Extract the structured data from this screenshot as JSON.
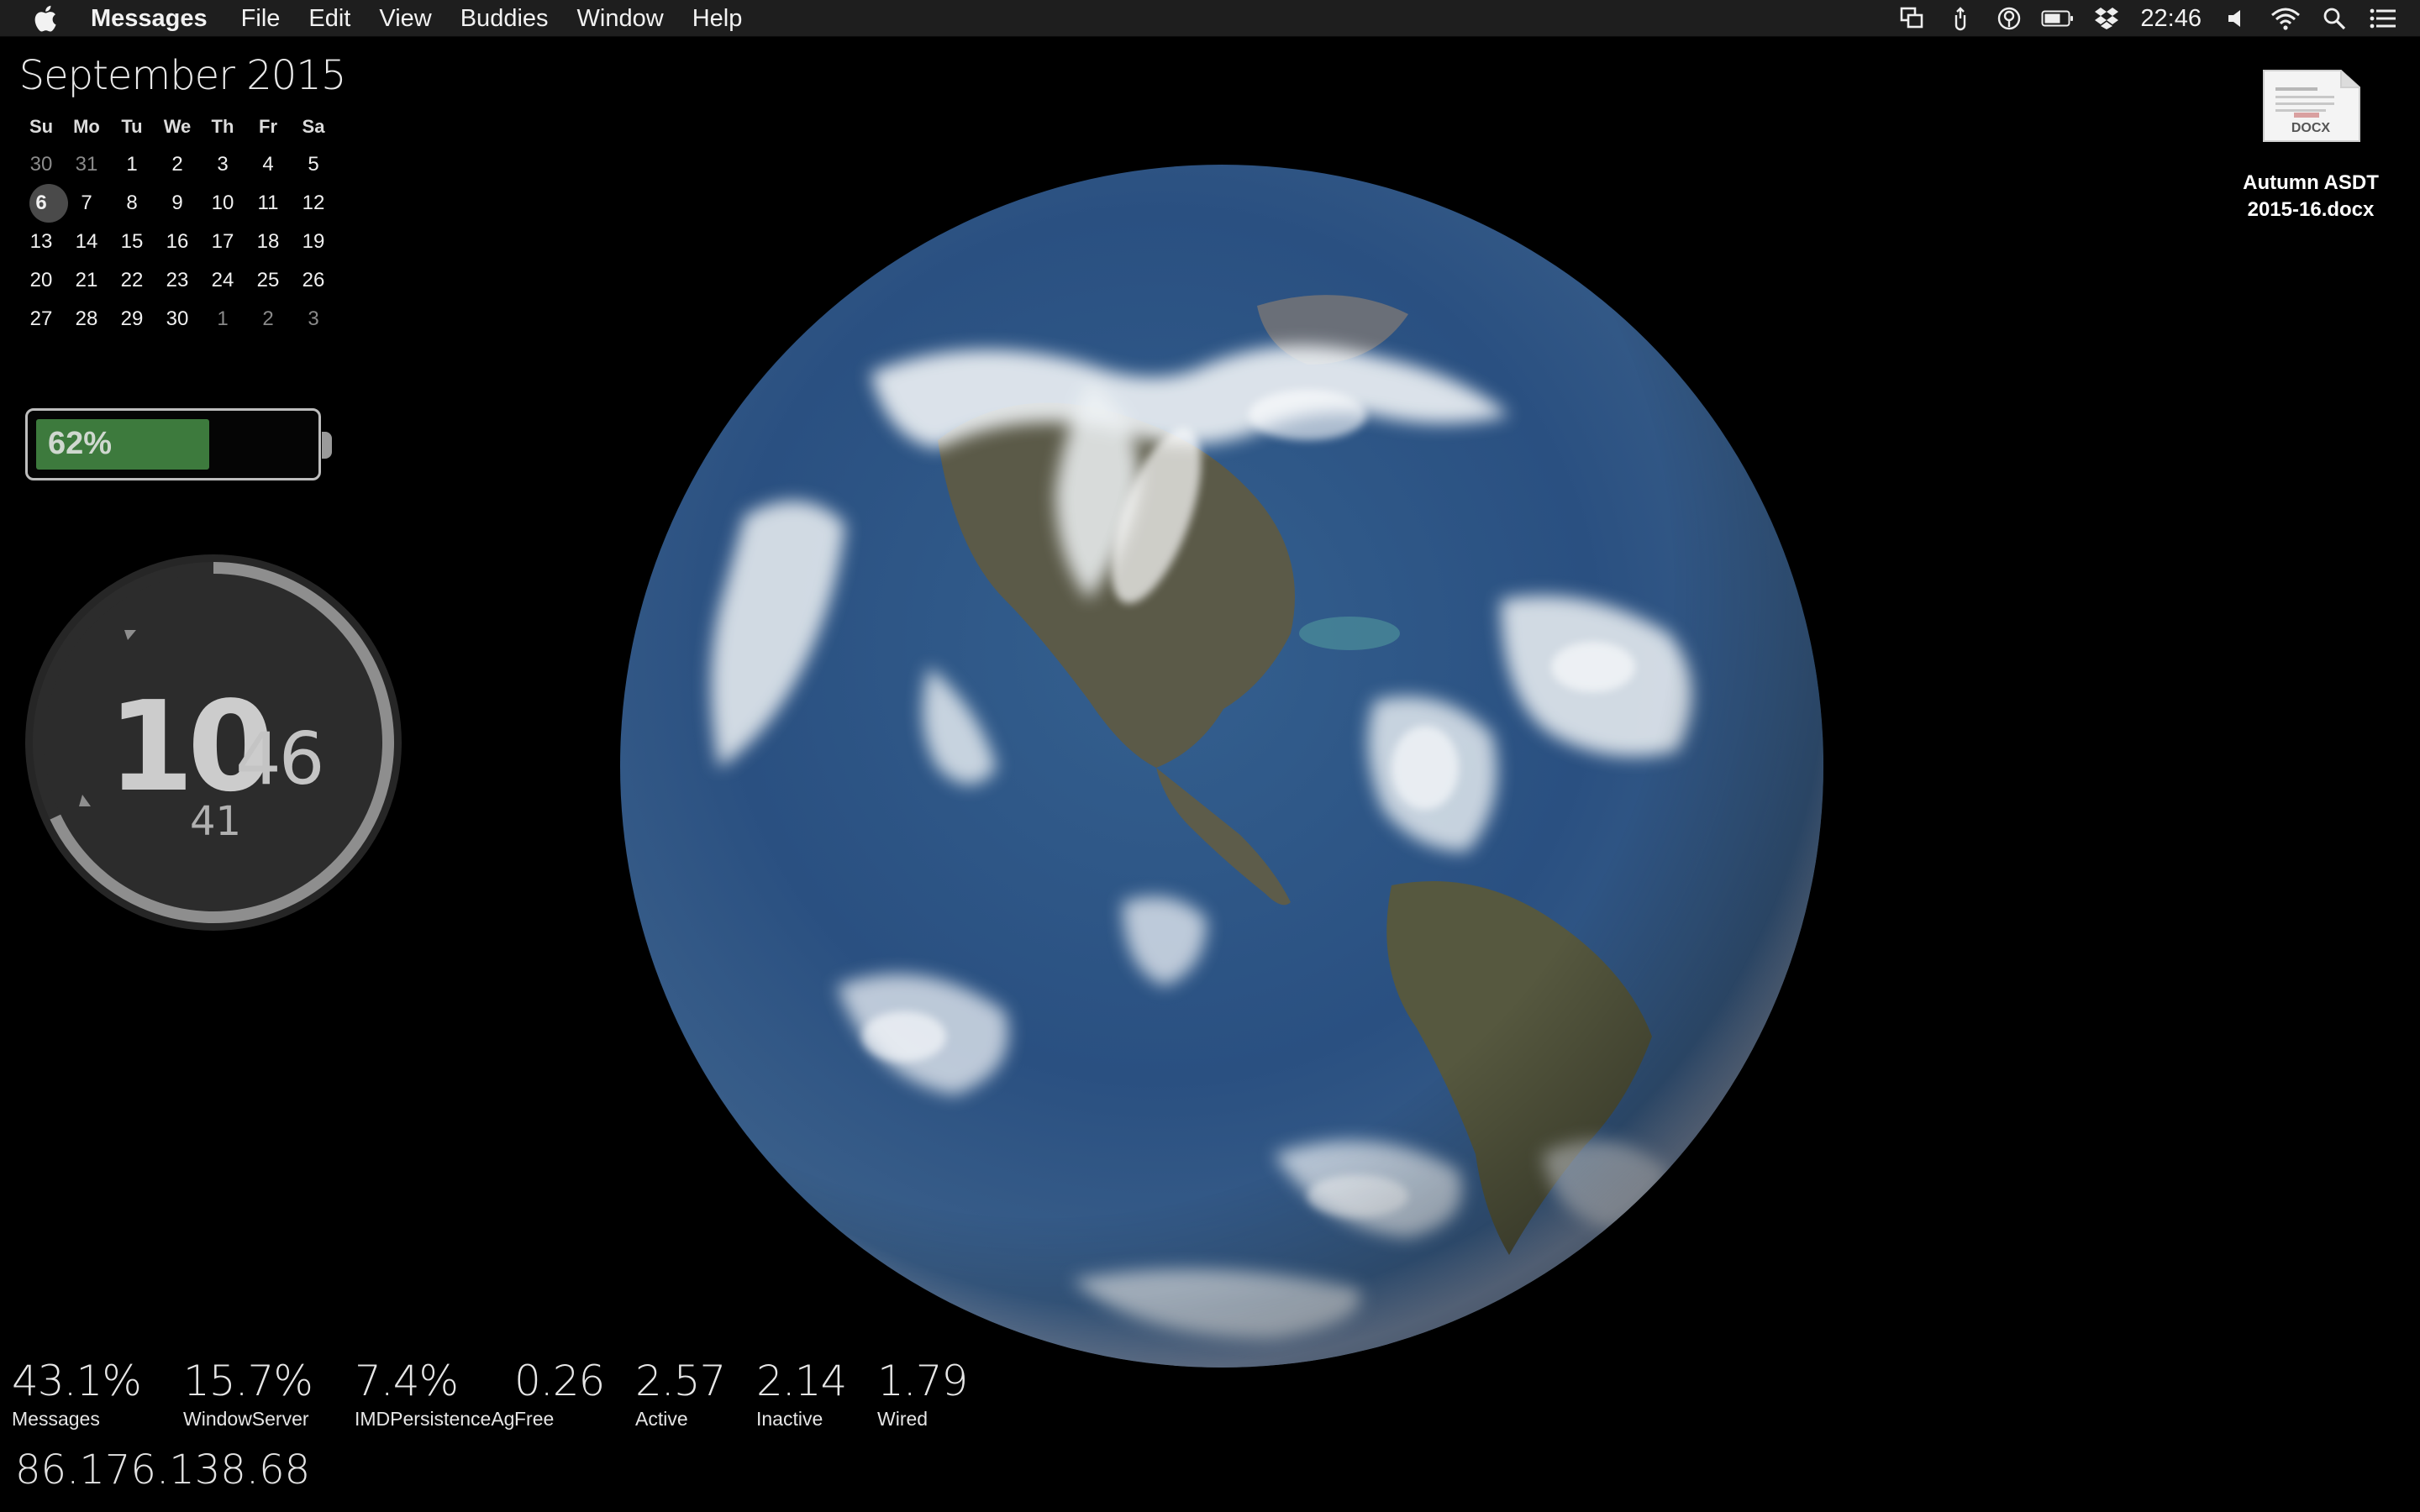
{
  "menubar": {
    "app_name": "Messages",
    "items": [
      "File",
      "Edit",
      "View",
      "Buddies",
      "Window",
      "Help"
    ],
    "status_icons": [
      "screen-share-icon",
      "bluetooth-arrow-icon",
      "sync-icon",
      "battery-icon",
      "dropbox-icon"
    ],
    "clock": "22:46",
    "right_icons": [
      "volume-icon",
      "wifi-icon",
      "spotlight-search-icon",
      "notification-center-icon"
    ]
  },
  "calendar": {
    "title": "September 2015",
    "weekdays": [
      "Su",
      "Mo",
      "Tu",
      "We",
      "Th",
      "Fr",
      "Sa"
    ],
    "weeks": [
      [
        "30",
        "31",
        "1",
        "2",
        "3",
        "4",
        "5"
      ],
      [
        "6",
        "7",
        "8",
        "9",
        "10",
        "11",
        "12"
      ],
      [
        "13",
        "14",
        "15",
        "16",
        "17",
        "18",
        "19"
      ],
      [
        "20",
        "21",
        "22",
        "23",
        "24",
        "25",
        "26"
      ],
      [
        "27",
        "28",
        "29",
        "30",
        "1",
        "2",
        "3"
      ]
    ],
    "today": "6"
  },
  "battery": {
    "label": "62%",
    "level": 0.62,
    "fill_color": "#3d7a3d"
  },
  "clock_widget": {
    "hour": "10",
    "minute": "46",
    "second": "41",
    "seconds_progress": 0.68
  },
  "desktop_file": {
    "badge": "DOCX",
    "name_line1": "Autumn ASDT",
    "name_line2": "2015-16.docx"
  },
  "stats": [
    {
      "value": "43.1%",
      "label": "Messages"
    },
    {
      "value": "15.7%",
      "label": "WindowServer"
    },
    {
      "value": "7.4%",
      "label": "IMDPersistenceAg"
    },
    {
      "value": "0.26",
      "label": "Free"
    },
    {
      "value": "2.57",
      "label": "Active"
    },
    {
      "value": "2.14",
      "label": "Inactive"
    },
    {
      "value": "1.79",
      "label": "Wired"
    }
  ],
  "ip_address": "86.176.138.68",
  "colors": {
    "desktop_bg": "#000000",
    "menubar_bg": "#1e1e1e",
    "ocean": "#2f5b8c",
    "cloud": "#e9eef2"
  }
}
